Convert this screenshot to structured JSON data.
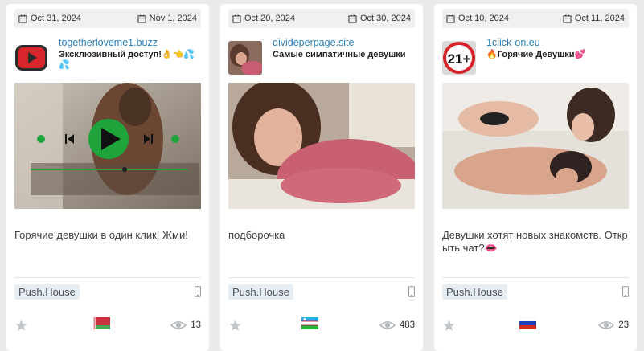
{
  "cards": [
    {
      "date_start": "Oct 31, 2024",
      "date_end": "Nov 1, 2024",
      "domain": "togetherloveme1.buzz",
      "title": "Эксклюзивный доступ!👌👈💦💦",
      "description": "Горячие девушки в один клик! Жми!",
      "network": "Push.House",
      "views": "13",
      "flag": "Belarus",
      "icon": "video-play-icon"
    },
    {
      "date_start": "Oct 20, 2024",
      "date_end": "Oct 30, 2024",
      "domain": "divideperpage.site",
      "title": "Самые симпатичные девушки",
      "description": "подборочка",
      "network": "Push.House",
      "views": "483",
      "flag": "Uzbekistan",
      "icon": "photo-thumbnail"
    },
    {
      "date_start": "Oct 10, 2024",
      "date_end": "Oct 11, 2024",
      "domain": "1click-on.eu",
      "title": "🔥Горячие Девушки💕",
      "description": "Девушки хотят новых знакомств. Открыть чат?👄",
      "network": "Push.House",
      "views": "23",
      "flag": "Russia",
      "icon": "age-21-plus-icon",
      "icon_text": "21+"
    }
  ],
  "colors": {
    "background": "#e9eaec",
    "domain_link": "#2a7fb6",
    "network_badge": "#e7eef3",
    "player_green": "#1fa43c"
  }
}
